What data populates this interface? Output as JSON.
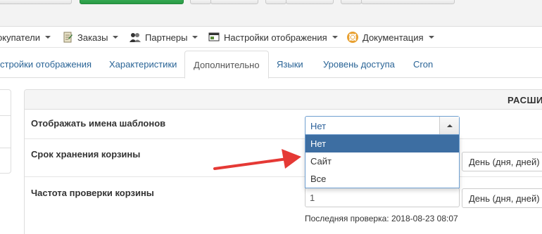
{
  "menu": {
    "items": [
      {
        "label": "окупатели",
        "icon": "users-icon"
      },
      {
        "label": "Заказы",
        "icon": "orders-icon"
      },
      {
        "label": "Партнеры",
        "icon": "partners-icon"
      },
      {
        "label": "Настройки отображения",
        "icon": "display-settings-icon"
      },
      {
        "label": "Документация",
        "icon": "lifebuoy-icon"
      }
    ]
  },
  "tabs": {
    "items": [
      {
        "label": "стройки отображения"
      },
      {
        "label": "Характеристики"
      },
      {
        "label": "Дополнительно",
        "active": true
      },
      {
        "label": "Языки"
      },
      {
        "label": "Уровень доступа"
      },
      {
        "label": "Cron"
      }
    ]
  },
  "panel": {
    "title": "РАСШИ"
  },
  "settings": {
    "show_template_names": {
      "label": "Отображать имена шаблонов",
      "value": "Нет",
      "options": [
        "Нет",
        "Сайт",
        "Все"
      ],
      "selected_option": "Нет"
    },
    "cart_storage": {
      "label": "Срок хранения корзины",
      "unit": "День (дня, дней)"
    },
    "cart_check_freq": {
      "label": "Частота проверки корзины",
      "value": "1",
      "unit": "День (дня, дней)",
      "last_check": "Последняя проверка: 2018-08-23 08:07"
    }
  },
  "colors": {
    "accent": "#3d6ea2",
    "link": "#2a6496",
    "annotation_arrow": "#e53935",
    "save_green": "#2a9a45"
  }
}
